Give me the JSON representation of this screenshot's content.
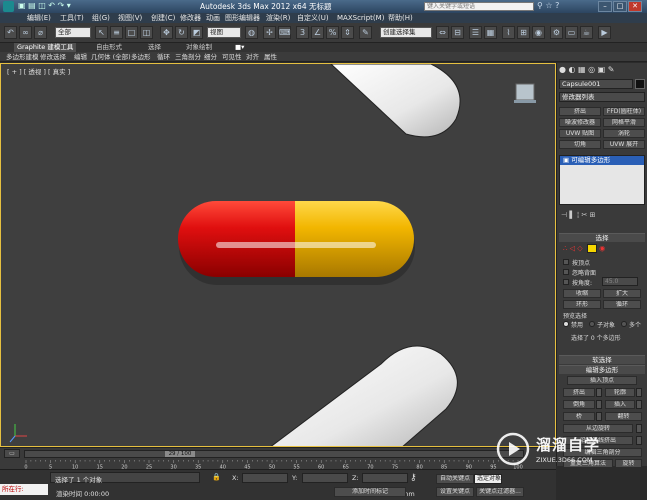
{
  "titlebar": {
    "title": "Autodesk 3ds Max  2012 x64     无标题",
    "search_placeholder": "键入关键字或短语",
    "minimize": "–",
    "maximize": "□",
    "close": "✕"
  },
  "menu": [
    {
      "id": "edit",
      "label": "编辑(E)"
    },
    {
      "id": "tools",
      "label": "工具(T)"
    },
    {
      "id": "group",
      "label": "组(G)"
    },
    {
      "id": "views",
      "label": "视图(V)"
    },
    {
      "id": "create",
      "label": "创建(C)"
    },
    {
      "id": "modifiers",
      "label": "修改器"
    },
    {
      "id": "animation",
      "label": "动画"
    },
    {
      "id": "graph-editors",
      "label": "图形编辑器"
    },
    {
      "id": "rendering",
      "label": "渲染(R)"
    },
    {
      "id": "customize",
      "label": "自定义(U)"
    },
    {
      "id": "maxscript",
      "label": "MAXScript(M)"
    },
    {
      "id": "help",
      "label": "帮助(H)"
    }
  ],
  "toolbar": {
    "selection_filter": "全部",
    "reference_coord": "视图",
    "named_selection": "创建选择集"
  },
  "ribbon": {
    "tabs": [
      "Graphite 建模工具",
      "自由形式",
      "选择",
      "对象绘制"
    ],
    "items": [
      "多边形建模",
      "修改选择",
      "编辑",
      "几何体 (全部)",
      "多边形",
      "循环",
      "三角剖分",
      "细分",
      "可见性",
      "对齐",
      "属性"
    ]
  },
  "viewport": {
    "label": "[ + ] [ 透视 ] [ 真实 ]",
    "capsule_left_color": "#d80a0a",
    "capsule_right_color": "#f2b600"
  },
  "command_panel": {
    "object_name": "Capsule001",
    "modifier_list": "修改器列表",
    "quick_buttons": [
      "挤出",
      "FFD(圆柱体)",
      "噪波修改器",
      "网格平滑",
      "UVW 贴图",
      "涡轮",
      "切角",
      "UVW 展开"
    ],
    "stack_item": "可编辑多边形",
    "selection_rollout": "选择",
    "by_vertex": "按顶点",
    "ignore_backfacing": "忽略背面",
    "by_angle": "按角度:",
    "angle_value": "45.0",
    "shrink": "收缩",
    "grow": "扩大",
    "ring": "环形",
    "loop": "循环",
    "preview_selection": "预览选择",
    "preview_options": [
      "禁用",
      "子对象",
      "多个"
    ],
    "selected_count": "选择了 0 个多边形",
    "soft_selection": "软选择",
    "edit_poly_rollout": "编辑多边形",
    "insert_vertex": "插入顶点",
    "edit_buttons": [
      [
        "挤出",
        "轮廓"
      ],
      [
        "倒角",
        "插入"
      ],
      [
        "桥",
        "翻转"
      ]
    ],
    "hinge": "从边旋转",
    "extrude_along_spline": "沿样条线挤出",
    "edit_triangulation": "编辑三角剖分",
    "retriangulate": "重复三角算法",
    "turn": "旋转"
  },
  "timeline": {
    "frame": "29 / 100",
    "ticks": [
      "0",
      "5",
      "10",
      "15",
      "20",
      "25",
      "30",
      "35",
      "40",
      "45",
      "50",
      "55",
      "60",
      "65",
      "70",
      "75",
      "80",
      "85",
      "90",
      "95",
      "100"
    ]
  },
  "status": {
    "running": "所在行:",
    "selected": "选择了 1 个对象",
    "prompt": "渲染时间 0:00:00",
    "x_label": "X:",
    "y_label": "Y:",
    "z_label": "Z:",
    "grid": "栅格 = 10.0mm",
    "add_time_tag": "添加时间标记",
    "auto_key": "自动关键点",
    "set_key": "设置关键点",
    "selected_obj": "选定对象",
    "key_filters": "关键点过滤器..."
  },
  "watermark": {
    "brand": "溜溜自学",
    "url": "ZIXUE.3D66.COM"
  }
}
